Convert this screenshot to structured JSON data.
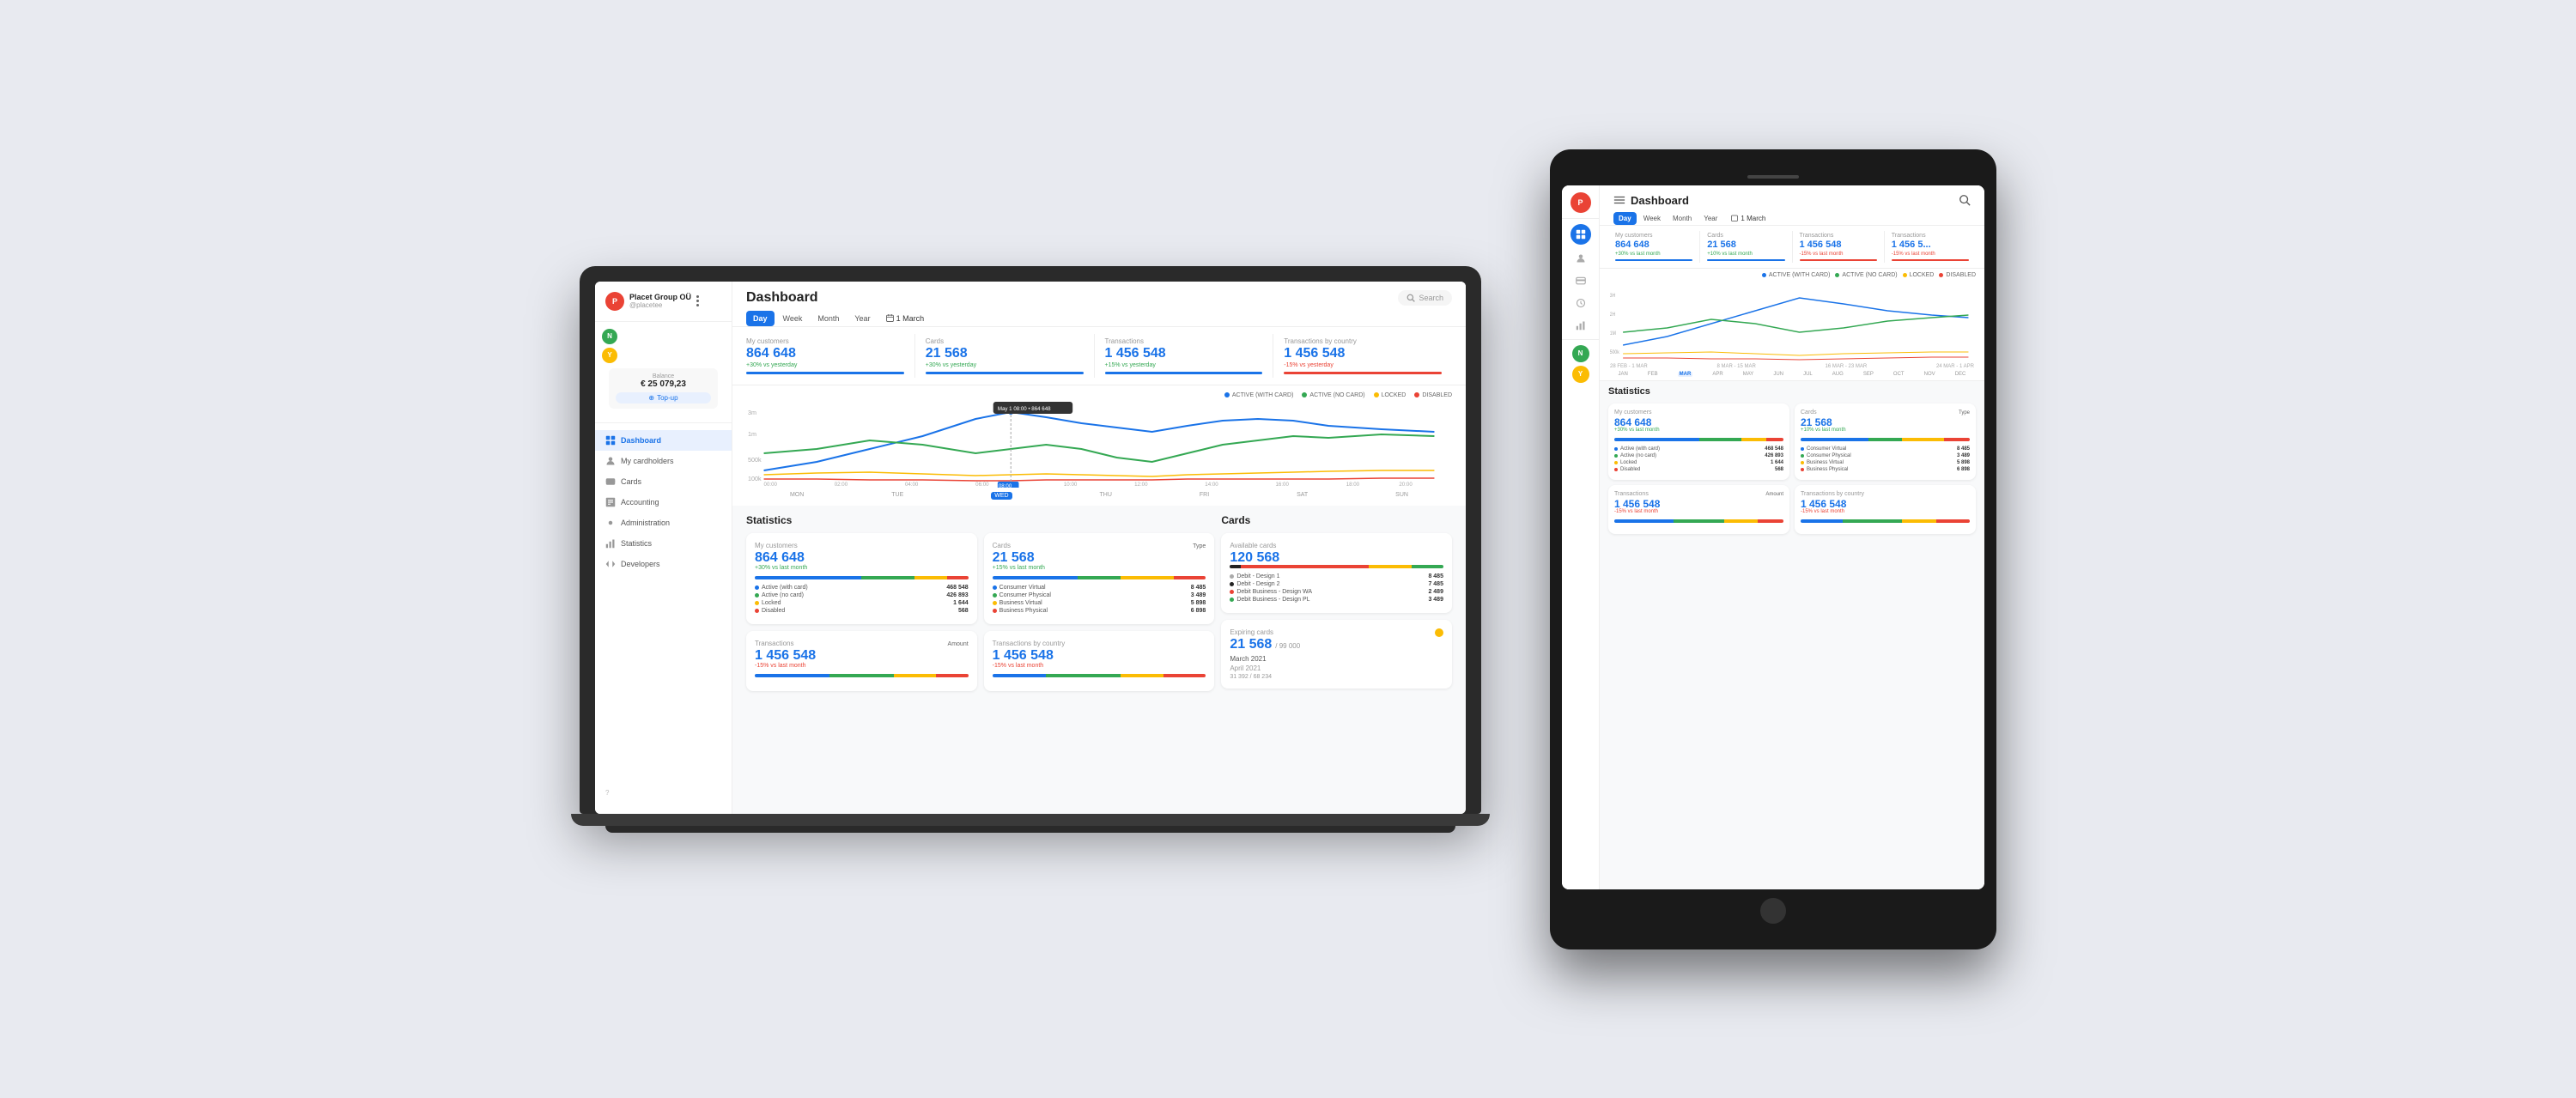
{
  "app": {
    "title": "Dashboard",
    "search_placeholder": "Search"
  },
  "company": {
    "name": "Placet Group OÜ",
    "handle": "@placetee",
    "balance_label": "Balance",
    "balance_amount": "€ 25 079,23",
    "topup": "Top-up"
  },
  "avatars": [
    {
      "letter": "P",
      "color": "#ea4335"
    },
    {
      "letter": "N",
      "color": "#34a853"
    },
    {
      "letter": "Y",
      "color": "#fbbc04"
    }
  ],
  "nav": [
    {
      "label": "Dashboard",
      "icon": "grid",
      "active": true
    },
    {
      "label": "My cardholders",
      "icon": "person",
      "active": false
    },
    {
      "label": "Cards",
      "icon": "card",
      "active": false
    },
    {
      "label": "Accounting",
      "icon": "accounting",
      "active": false
    },
    {
      "label": "Administration",
      "icon": "admin",
      "active": false
    },
    {
      "label": "Statistics",
      "icon": "stats",
      "active": false
    },
    {
      "label": "Developers",
      "icon": "dev",
      "active": false
    }
  ],
  "tabs": [
    "Day",
    "Week",
    "Month",
    "Year"
  ],
  "active_tab": "Day",
  "date": "1 March",
  "kpis": [
    {
      "label": "My customers",
      "value": "864 648",
      "change": "+30% vs yesterday",
      "positive": true
    },
    {
      "label": "Cards",
      "value": "21 568",
      "change": "+30% vs yesterday",
      "positive": true
    },
    {
      "label": "Transactions",
      "value": "1 456 548",
      "change": "+15% vs yesterday",
      "positive": true
    },
    {
      "label": "Transactions by country",
      "value": "1 456 548",
      "change": "-15% vs yesterday",
      "positive": false
    }
  ],
  "chart_legend": [
    {
      "label": "ACTIVE (WITH CARD)",
      "color": "#1a73e8"
    },
    {
      "label": "ACTIVE (NO CARD)",
      "color": "#34a853"
    },
    {
      "label": "LOCKED",
      "color": "#fbbc04"
    },
    {
      "label": "DISABLED",
      "color": "#ea4335"
    }
  ],
  "chart_days": [
    "MON",
    "TUE",
    "WED",
    "THU",
    "FRI",
    "SAT",
    "SUN"
  ],
  "active_day": "WED",
  "tooltip": "May 1 08:00 • 864 648",
  "stats_title": "Statistics",
  "stats": [
    {
      "label": "My customers",
      "value": "864 648",
      "change": "+30% vs last month",
      "positive": true,
      "bars": [
        {
          "color": "#1a73e8",
          "pct": 50
        },
        {
          "color": "#34a853",
          "pct": 25
        },
        {
          "color": "#fbbc04",
          "pct": 15
        },
        {
          "color": "#ea4335",
          "pct": 10
        }
      ],
      "details": [
        {
          "label": "Active (with card)",
          "color": "#1a73e8",
          "val": "468 548"
        },
        {
          "label": "Active (no card)",
          "color": "#34a853",
          "val": "426 893"
        },
        {
          "label": "Locked",
          "color": "#fbbc04",
          "val": "1 644"
        },
        {
          "label": "Disabled",
          "color": "#ea4335",
          "val": "568"
        }
      ]
    },
    {
      "label": "Cards",
      "value": "21 568",
      "change": "+15% vs last month",
      "positive": true,
      "filter": "Type",
      "bars": [
        {
          "color": "#1a73e8",
          "pct": 40
        },
        {
          "color": "#34a853",
          "pct": 20
        },
        {
          "color": "#fbbc04",
          "pct": 25
        },
        {
          "color": "#ea4335",
          "pct": 15
        }
      ],
      "details": [
        {
          "label": "Consumer Virtual",
          "color": "#1a73e8",
          "val": "8 485"
        },
        {
          "label": "Consumer Physical",
          "color": "#34a853",
          "val": "3 489"
        },
        {
          "label": "Business Virtual",
          "color": "#fbbc04",
          "val": "5 898"
        },
        {
          "label": "Business Physical",
          "color": "#ea4335",
          "val": "6 898"
        }
      ]
    },
    {
      "label": "Transactions",
      "value": "1 456 548",
      "change": "-15% vs last month",
      "positive": false,
      "filter": "Amount",
      "bars": [
        {
          "color": "#1a73e8",
          "pct": 35
        },
        {
          "color": "#34a853",
          "pct": 30
        },
        {
          "color": "#fbbc04",
          "pct": 20
        },
        {
          "color": "#ea4335",
          "pct": 15
        }
      ]
    },
    {
      "label": "Transactions by country",
      "value": "1 456 548",
      "change": "-15% vs last month",
      "positive": false,
      "bars": [
        {
          "color": "#1a73e8",
          "pct": 25
        },
        {
          "color": "#34a853",
          "pct": 35
        },
        {
          "color": "#fbbc04",
          "pct": 20
        },
        {
          "color": "#ea4335",
          "pct": 20
        }
      ]
    }
  ],
  "cards_title": "Cards",
  "available_cards": {
    "label": "Available cards",
    "value": "120 568",
    "bar": [
      {
        "color": "#222",
        "pct": 5
      },
      {
        "color": "#ea4335",
        "pct": 70
      },
      {
        "color": "#fbbc04",
        "pct": 15
      },
      {
        "color": "#34a853",
        "pct": 10
      }
    ],
    "items": [
      {
        "label": "Debit - Design 1",
        "color": "#aaa",
        "val": "8 485"
      },
      {
        "label": "Debit - Design 2",
        "color": "#222",
        "val": "7 485"
      },
      {
        "label": "Debit Business - Design WA",
        "color": "#ea4335",
        "val": "2 489"
      },
      {
        "label": "Debit Business - Design PL",
        "color": "#34a853",
        "val": "3 489"
      }
    ]
  },
  "expiring_cards": {
    "label": "Expiring cards",
    "value": "21 568",
    "sub": "/ 99 000",
    "month1": "March 2021",
    "month2": "April 2021"
  }
}
